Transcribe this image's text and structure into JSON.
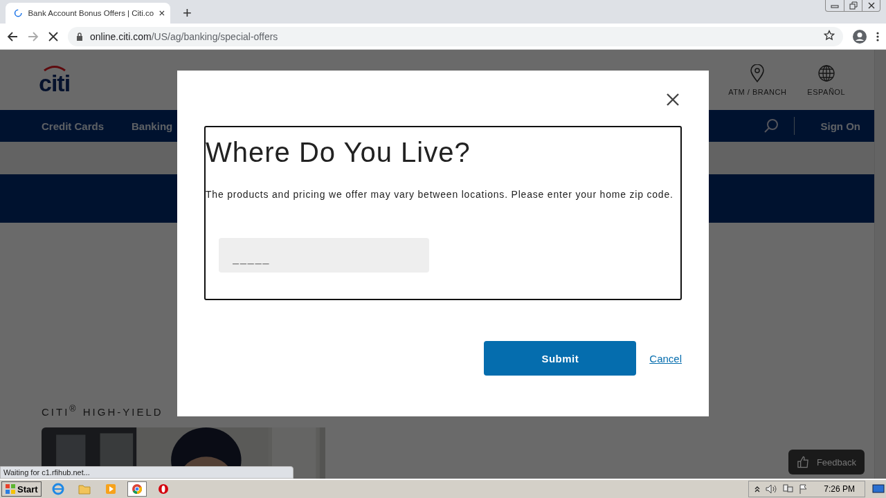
{
  "browser": {
    "tab": {
      "title": "Bank Account Bonus Offers | Citi.co",
      "loading": true
    },
    "new_tab": "+",
    "address": {
      "host": "online.citi.com",
      "path": "/US/ag/banking/special-offers"
    },
    "status": "Waiting for c1.rfihub.net..."
  },
  "page": {
    "logo": "citi",
    "utilities": [
      {
        "kind": "location",
        "label": "ATM / BRANCH"
      },
      {
        "kind": "language",
        "label": "ESPAÑOL"
      }
    ],
    "nav": {
      "items": [
        "Credit Cards",
        "Banking"
      ],
      "sign_on": "Sign On"
    },
    "section_title": "CITI$^{®}$ HIGH-YIELD",
    "feedback": "Feedback"
  },
  "modal": {
    "title": "Where Do You Live?",
    "description": "The products and pricing we offer may vary between locations. Please enter your home zip code.",
    "zip_field": {
      "placeholder": "_____"
    },
    "submit": "Submit",
    "cancel": "Cancel"
  },
  "taskbar": {
    "start": "Start",
    "clock": "7:26 PM"
  }
}
